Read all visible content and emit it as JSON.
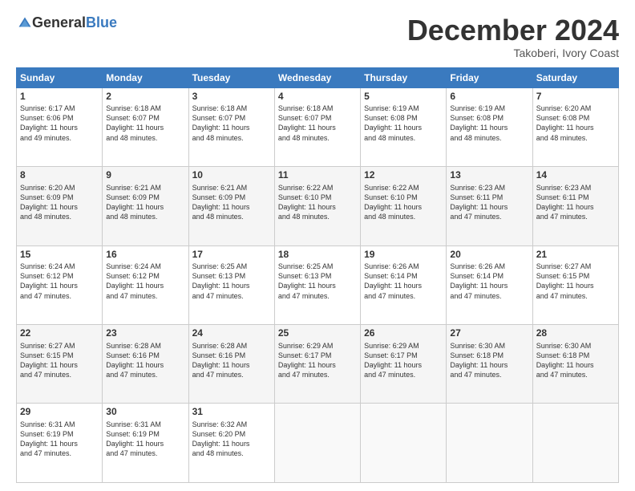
{
  "logo": {
    "general": "General",
    "blue": "Blue"
  },
  "title": "December 2024",
  "location": "Takoberi, Ivory Coast",
  "days": [
    "Sunday",
    "Monday",
    "Tuesday",
    "Wednesday",
    "Thursday",
    "Friday",
    "Saturday"
  ],
  "weeks": [
    [
      {
        "day": "1",
        "text": "Sunrise: 6:17 AM\nSunset: 6:06 PM\nDaylight: 11 hours\nand 49 minutes."
      },
      {
        "day": "2",
        "text": "Sunrise: 6:18 AM\nSunset: 6:07 PM\nDaylight: 11 hours\nand 48 minutes."
      },
      {
        "day": "3",
        "text": "Sunrise: 6:18 AM\nSunset: 6:07 PM\nDaylight: 11 hours\nand 48 minutes."
      },
      {
        "day": "4",
        "text": "Sunrise: 6:18 AM\nSunset: 6:07 PM\nDaylight: 11 hours\nand 48 minutes."
      },
      {
        "day": "5",
        "text": "Sunrise: 6:19 AM\nSunset: 6:08 PM\nDaylight: 11 hours\nand 48 minutes."
      },
      {
        "day": "6",
        "text": "Sunrise: 6:19 AM\nSunset: 6:08 PM\nDaylight: 11 hours\nand 48 minutes."
      },
      {
        "day": "7",
        "text": "Sunrise: 6:20 AM\nSunset: 6:08 PM\nDaylight: 11 hours\nand 48 minutes."
      }
    ],
    [
      {
        "day": "8",
        "text": "Sunrise: 6:20 AM\nSunset: 6:09 PM\nDaylight: 11 hours\nand 48 minutes."
      },
      {
        "day": "9",
        "text": "Sunrise: 6:21 AM\nSunset: 6:09 PM\nDaylight: 11 hours\nand 48 minutes."
      },
      {
        "day": "10",
        "text": "Sunrise: 6:21 AM\nSunset: 6:09 PM\nDaylight: 11 hours\nand 48 minutes."
      },
      {
        "day": "11",
        "text": "Sunrise: 6:22 AM\nSunset: 6:10 PM\nDaylight: 11 hours\nand 48 minutes."
      },
      {
        "day": "12",
        "text": "Sunrise: 6:22 AM\nSunset: 6:10 PM\nDaylight: 11 hours\nand 48 minutes."
      },
      {
        "day": "13",
        "text": "Sunrise: 6:23 AM\nSunset: 6:11 PM\nDaylight: 11 hours\nand 47 minutes."
      },
      {
        "day": "14",
        "text": "Sunrise: 6:23 AM\nSunset: 6:11 PM\nDaylight: 11 hours\nand 47 minutes."
      }
    ],
    [
      {
        "day": "15",
        "text": "Sunrise: 6:24 AM\nSunset: 6:12 PM\nDaylight: 11 hours\nand 47 minutes."
      },
      {
        "day": "16",
        "text": "Sunrise: 6:24 AM\nSunset: 6:12 PM\nDaylight: 11 hours\nand 47 minutes."
      },
      {
        "day": "17",
        "text": "Sunrise: 6:25 AM\nSunset: 6:13 PM\nDaylight: 11 hours\nand 47 minutes."
      },
      {
        "day": "18",
        "text": "Sunrise: 6:25 AM\nSunset: 6:13 PM\nDaylight: 11 hours\nand 47 minutes."
      },
      {
        "day": "19",
        "text": "Sunrise: 6:26 AM\nSunset: 6:14 PM\nDaylight: 11 hours\nand 47 minutes."
      },
      {
        "day": "20",
        "text": "Sunrise: 6:26 AM\nSunset: 6:14 PM\nDaylight: 11 hours\nand 47 minutes."
      },
      {
        "day": "21",
        "text": "Sunrise: 6:27 AM\nSunset: 6:15 PM\nDaylight: 11 hours\nand 47 minutes."
      }
    ],
    [
      {
        "day": "22",
        "text": "Sunrise: 6:27 AM\nSunset: 6:15 PM\nDaylight: 11 hours\nand 47 minutes."
      },
      {
        "day": "23",
        "text": "Sunrise: 6:28 AM\nSunset: 6:16 PM\nDaylight: 11 hours\nand 47 minutes."
      },
      {
        "day": "24",
        "text": "Sunrise: 6:28 AM\nSunset: 6:16 PM\nDaylight: 11 hours\nand 47 minutes."
      },
      {
        "day": "25",
        "text": "Sunrise: 6:29 AM\nSunset: 6:17 PM\nDaylight: 11 hours\nand 47 minutes."
      },
      {
        "day": "26",
        "text": "Sunrise: 6:29 AM\nSunset: 6:17 PM\nDaylight: 11 hours\nand 47 minutes."
      },
      {
        "day": "27",
        "text": "Sunrise: 6:30 AM\nSunset: 6:18 PM\nDaylight: 11 hours\nand 47 minutes."
      },
      {
        "day": "28",
        "text": "Sunrise: 6:30 AM\nSunset: 6:18 PM\nDaylight: 11 hours\nand 47 minutes."
      }
    ],
    [
      {
        "day": "29",
        "text": "Sunrise: 6:31 AM\nSunset: 6:19 PM\nDaylight: 11 hours\nand 47 minutes."
      },
      {
        "day": "30",
        "text": "Sunrise: 6:31 AM\nSunset: 6:19 PM\nDaylight: 11 hours\nand 47 minutes."
      },
      {
        "day": "31",
        "text": "Sunrise: 6:32 AM\nSunset: 6:20 PM\nDaylight: 11 hours\nand 48 minutes."
      },
      {
        "day": "",
        "text": ""
      },
      {
        "day": "",
        "text": ""
      },
      {
        "day": "",
        "text": ""
      },
      {
        "day": "",
        "text": ""
      }
    ]
  ]
}
